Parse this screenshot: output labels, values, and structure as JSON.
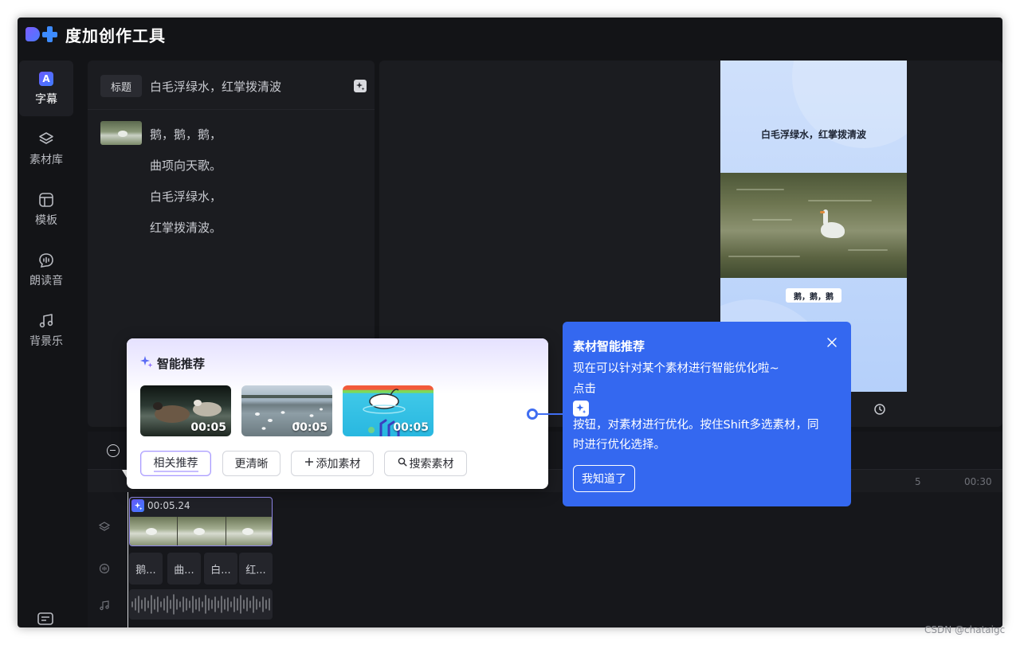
{
  "app": {
    "name": "度加创作工具",
    "brand_colors": {
      "purple": "#6a5cff",
      "blue": "#3d8bff",
      "tooltip_blue": "#3468f0"
    }
  },
  "sidebar": {
    "items": [
      {
        "label": "字幕",
        "icon": "subtitle-a-icon",
        "active": true
      },
      {
        "label": "素材库",
        "icon": "layers-icon",
        "active": false
      },
      {
        "label": "模板",
        "icon": "template-icon",
        "active": false
      },
      {
        "label": "朗读音",
        "icon": "voice-icon",
        "active": false
      },
      {
        "label": "背景乐",
        "icon": "music-note-icon",
        "active": false
      }
    ],
    "bottom_icon": "keyboard-icon"
  },
  "script_panel": {
    "title_tag": "标题",
    "title_text": "白毛浮绿水，红掌拨清波",
    "lines": [
      "鹅，鹅，鹅，",
      "曲项向天歌。",
      "白毛浮绿水，",
      "红掌拨清波。"
    ]
  },
  "preview": {
    "title": "白毛浮绿水，红掌拨清波",
    "subtitle": "鹅，鹅，鹅"
  },
  "timeline": {
    "ruler_labels": [
      "00",
      "5",
      "00:30"
    ],
    "clip_duration": "00:05.24",
    "subtitle_chips": [
      "鹅...",
      "曲...",
      "白...",
      "红..."
    ]
  },
  "smart_card": {
    "title": "智能推荐",
    "media": [
      {
        "duration": "00:05"
      },
      {
        "duration": "00:05"
      },
      {
        "duration": "00:05"
      }
    ],
    "buttons": [
      {
        "label": "相关推荐",
        "active": true
      },
      {
        "label": "更清晰",
        "active": false
      },
      {
        "label": "添加素材",
        "active": false,
        "prefix": "+"
      },
      {
        "label": "搜索素材",
        "active": false,
        "prefix": "search"
      }
    ]
  },
  "tooltip": {
    "title": "素材智能推荐",
    "line1": "现在可以针对某个素材进行智能优化啦~",
    "line2": "点击",
    "line3": "按钮，对素材进行优化。按住Shift多选素材，同",
    "line4": "时进行优化选择。",
    "button": "我知道了"
  },
  "watermark": "CSDN @chataigc"
}
